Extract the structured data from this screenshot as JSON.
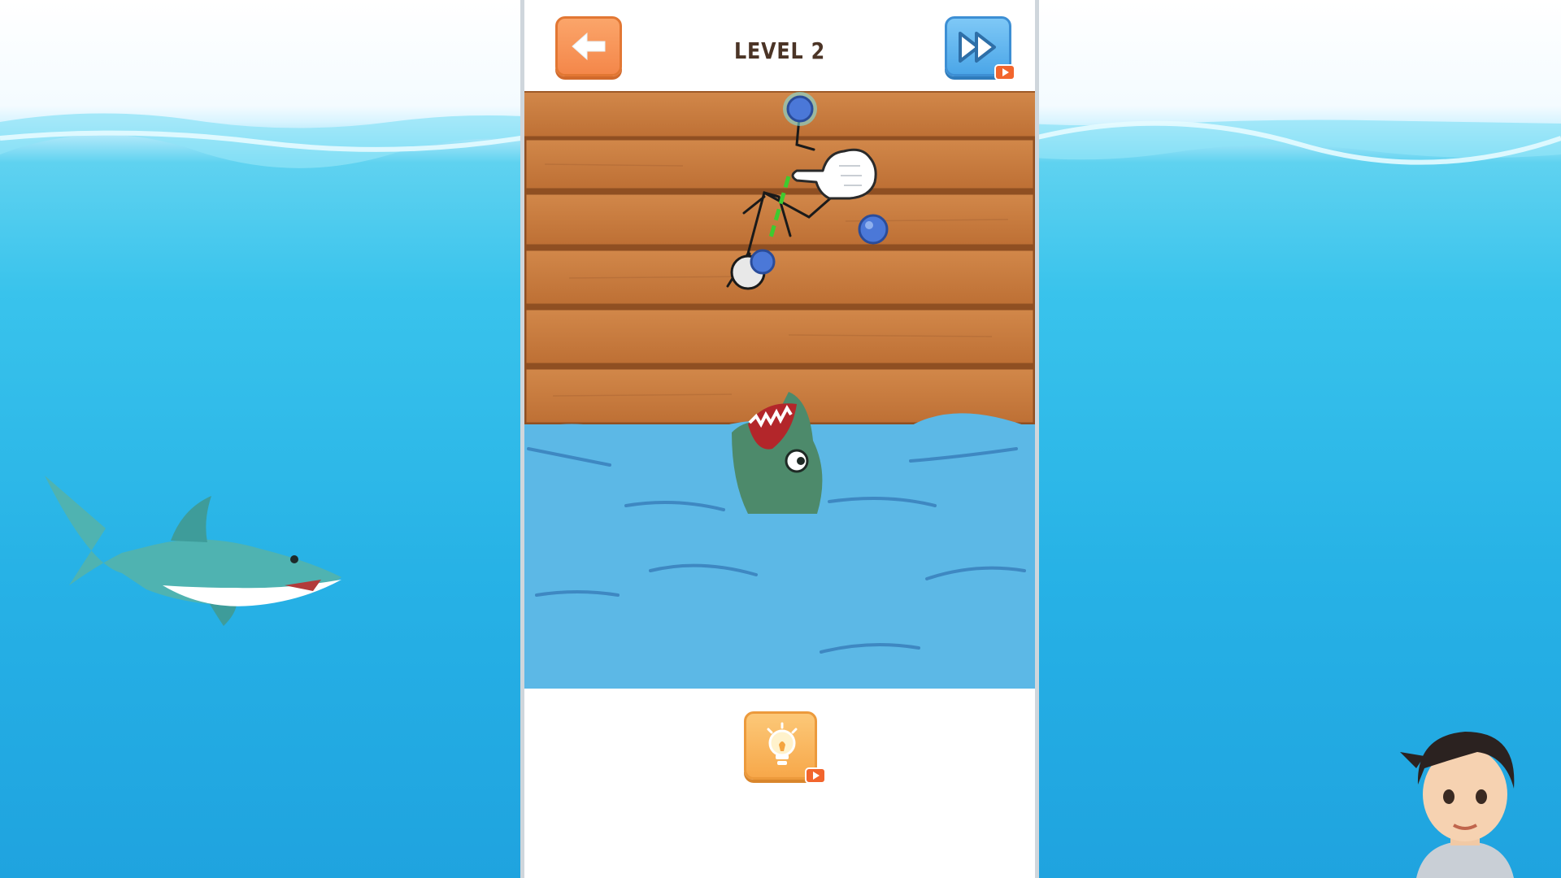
{
  "game": {
    "level_title": "LEVEL 2"
  },
  "toolbar": {
    "back_icon": "arrow-left-icon",
    "skip_icon": "fast-forward-icon",
    "skip_badge_icon": "video-ad-icon"
  },
  "hint": {
    "icon": "lightbulb-icon",
    "badge_icon": "video-ad-icon"
  },
  "colors": {
    "sky": "#ffffff",
    "ocean": "#27b2e6",
    "wood": "#c8793d",
    "game_water": "#5cb8e6",
    "back_button": "#f4874a",
    "skip_button": "#4ba6e8",
    "hint_button": "#f7a84a",
    "pin": "#4b78d8",
    "rope_guide": "#3ecb2f"
  }
}
